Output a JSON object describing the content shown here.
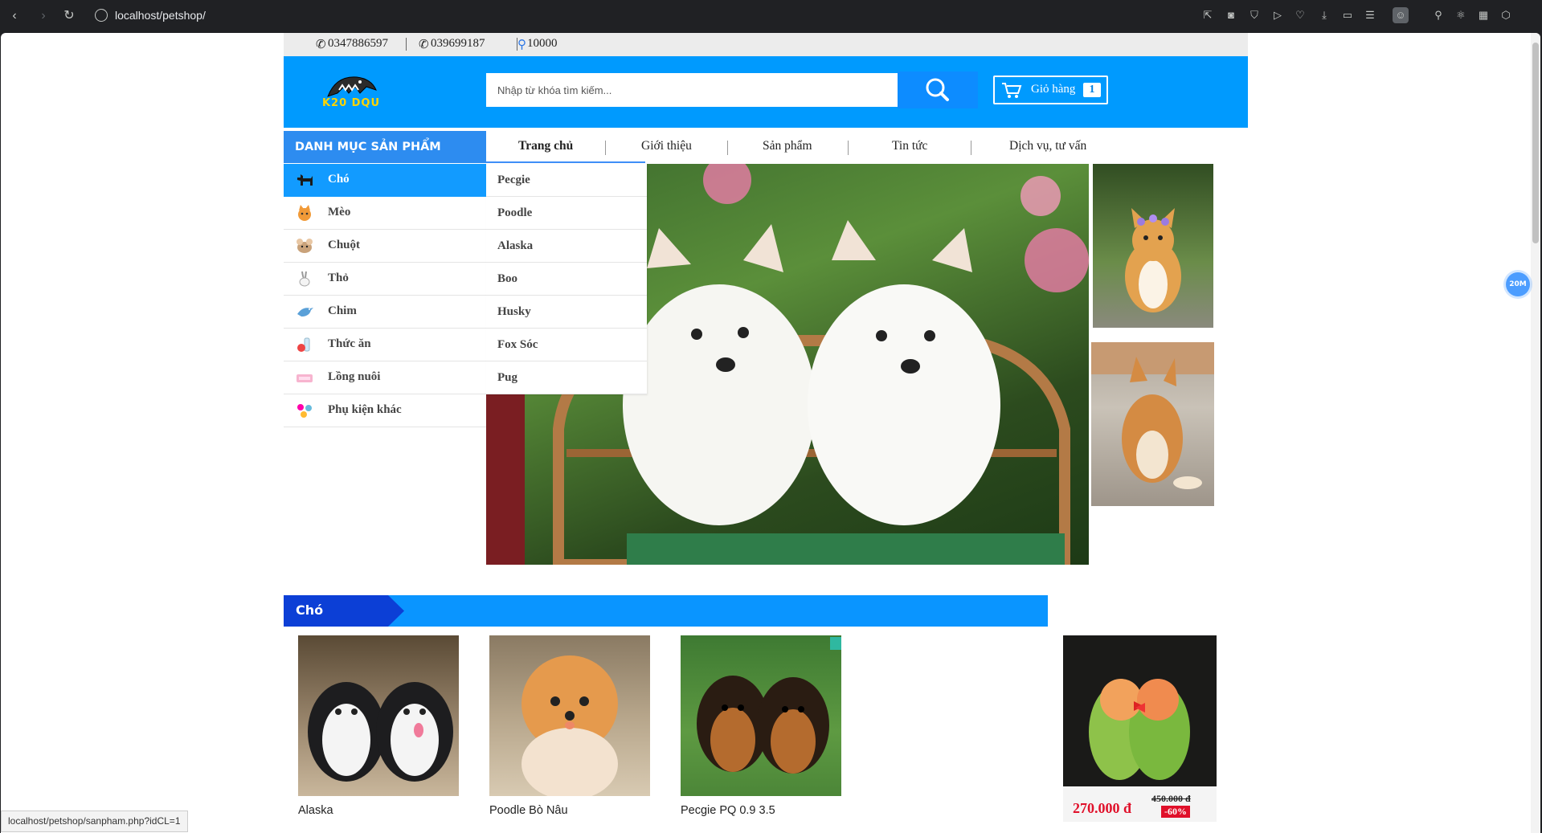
{
  "browser": {
    "url": "localhost/petshop/",
    "status_link": "localhost/petshop/sanpham.php?idCL=1"
  },
  "topbar": {
    "phone1": "0347886597",
    "phone2": "039699187",
    "location": "10000"
  },
  "header": {
    "logo_text": "K20 DQU",
    "search_placeholder": "Nhập từ khóa tìm kiếm...",
    "cart_label": "Giỏ hàng",
    "cart_count": "1"
  },
  "sidebar": {
    "title": "DANH MỤC SẢN PHẨM",
    "items": [
      {
        "label": "Chó",
        "icon": "dog-icon"
      },
      {
        "label": "Mèo",
        "icon": "cat-icon"
      },
      {
        "label": "Chuột",
        "icon": "mouse-icon"
      },
      {
        "label": "Thỏ",
        "icon": "rabbit-icon"
      },
      {
        "label": "Chim",
        "icon": "bird-icon"
      },
      {
        "label": "Thức ăn",
        "icon": "food-icon"
      },
      {
        "label": "Lồng nuôi",
        "icon": "cage-icon"
      },
      {
        "label": "Phụ kiện khác",
        "icon": "accessories-icon"
      }
    ],
    "submenu": [
      "Pecgie",
      "Poodle",
      "Alaska",
      "Boo",
      "Husky",
      "Fox Sóc",
      "Pug"
    ]
  },
  "mainnav": {
    "items": [
      "Trang chủ",
      "Giới thiệu",
      "Sản phẩm",
      "Tin tức",
      "Dịch vụ, tư vấn"
    ]
  },
  "section": {
    "title": "Chó"
  },
  "products": [
    {
      "name": "Alaska"
    },
    {
      "name": "Poodle Bò Nâu"
    },
    {
      "name": "Pecgie PQ 0.9 3.5"
    }
  ],
  "ad": {
    "price": "270.000 đ",
    "old_price": "450.000 đ",
    "discount": "-60%"
  },
  "zoom_badge": "20M",
  "colors": {
    "brand_blue": "#009afe",
    "accent_blue": "#129bff",
    "price_red": "#e0102a"
  }
}
